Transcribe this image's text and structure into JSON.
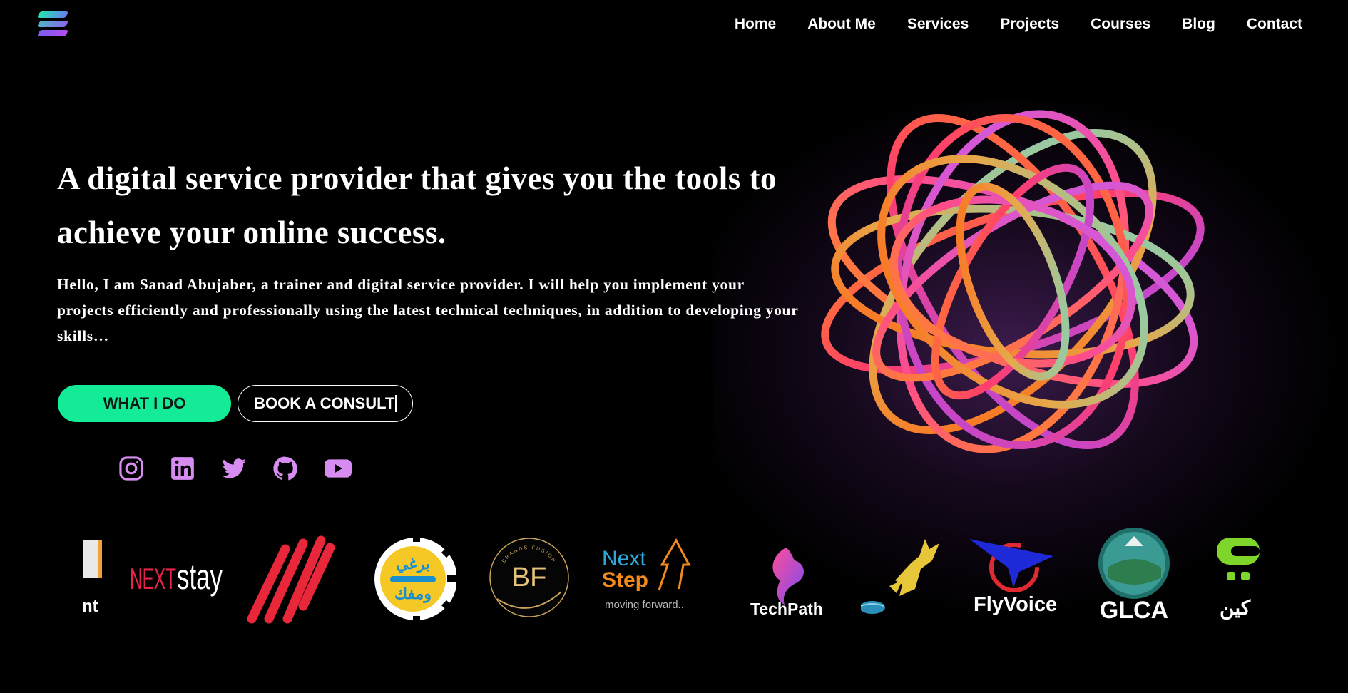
{
  "nav": {
    "items": [
      "Home",
      "About Me",
      "Services",
      "Projects",
      "Courses",
      "Blog",
      "Contact"
    ]
  },
  "hero": {
    "headline": "A digital service provider that gives you the tools to achieve your online success.",
    "intro": "Hello, I am Sanad Abujaber, a trainer and digital service provider. I will help you implement your projects efficiently and professionally using the latest technical techniques, in addition to developing your skills…",
    "primary_button": "WHAT I DO",
    "secondary_button": "BOOK A CONSULT"
  },
  "socials": {
    "icons": [
      "instagram-icon",
      "linkedin-icon",
      "twitter-icon",
      "github-icon",
      "youtube-icon"
    ],
    "color": "#d68cf0"
  },
  "brands": {
    "nextstay": {
      "left": "NEXT",
      "right": "stay"
    },
    "brands_fusion_ring": "BRANDS FUSION",
    "brands_fusion_mark": "BF",
    "arabic_badge": {
      "line1": "برغي",
      "line2": "ومفك"
    },
    "nextstep": {
      "line1": "Next",
      "line2": "Step",
      "tagline": "moving forward.."
    },
    "techpath": "TechPath",
    "flyvoice": "FlyVoice",
    "glca": "GLCA",
    "partial_left": "nt",
    "partial_right": "كين"
  },
  "colors": {
    "accent": "#14eb96",
    "background": "#000000",
    "social": "#d68cf0"
  }
}
